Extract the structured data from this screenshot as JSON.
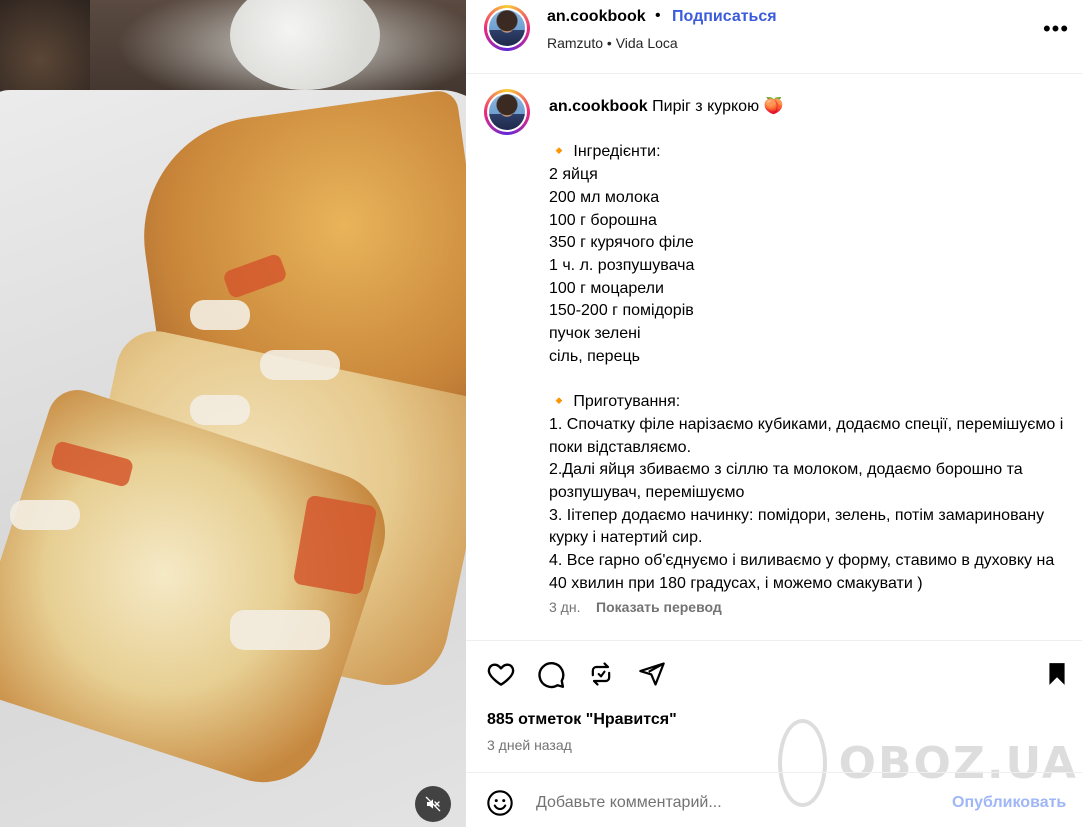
{
  "post": {
    "username": "an.cookbook",
    "separator": "•",
    "follow_label": "Подписаться",
    "audio": "Ramzuto • Vida Loca",
    "more_label": "•••"
  },
  "caption": {
    "username": "an.cookbook",
    "text": " Пиріг з куркою 🍑\n\n🔸 Інгредієнти:\n2 яйця\n200 мл молока\n100 г борошна\n350 г курячого філе\n1 ч. л. розпушувача\n100 г моцарели\n150-200 г помідорів\nпучок зелені\nсіль, перець\n\n🔸 Приготування:\n1. Спочатку філе нарізаємо кубиками, додаємо спеції, перемішуємо і поки відставляємо.\n2.Далі яйця збиваємо з сіллю та молоком, додаємо борошно та розпушувач, перемішуємо\n3. Іітепер додаємо начинку: помідори, зелень, потім замариновану курку і натертий сир.\n4. Все гарно об'єднуємо і виливаємо у форму, ставимо в духовку на 40 хвилин при 180 градусах, і можемо смакувати )",
    "age": "3 дн.",
    "translate_label": "Показать перевод"
  },
  "actions": {
    "like_icon": "heart-icon",
    "comment_icon": "comment-icon",
    "repost_icon": "repost-icon",
    "share_icon": "share-icon",
    "save_icon": "bookmark-icon"
  },
  "likes_text": "885 отметок \"Нравится\"",
  "timestamp": "3 дней назад",
  "comment": {
    "placeholder": "Добавьте комментарий...",
    "post_label": "Опубликовать",
    "emoji_icon": "smiley-icon"
  },
  "media": {
    "mute_icon": "speaker-muted-icon"
  },
  "watermark": {
    "text": "OBOZ.UA"
  },
  "colors": {
    "accent": "#3b5bdb",
    "post_button_disabled": "#9fb6f7",
    "secondary_text": "#737373"
  }
}
